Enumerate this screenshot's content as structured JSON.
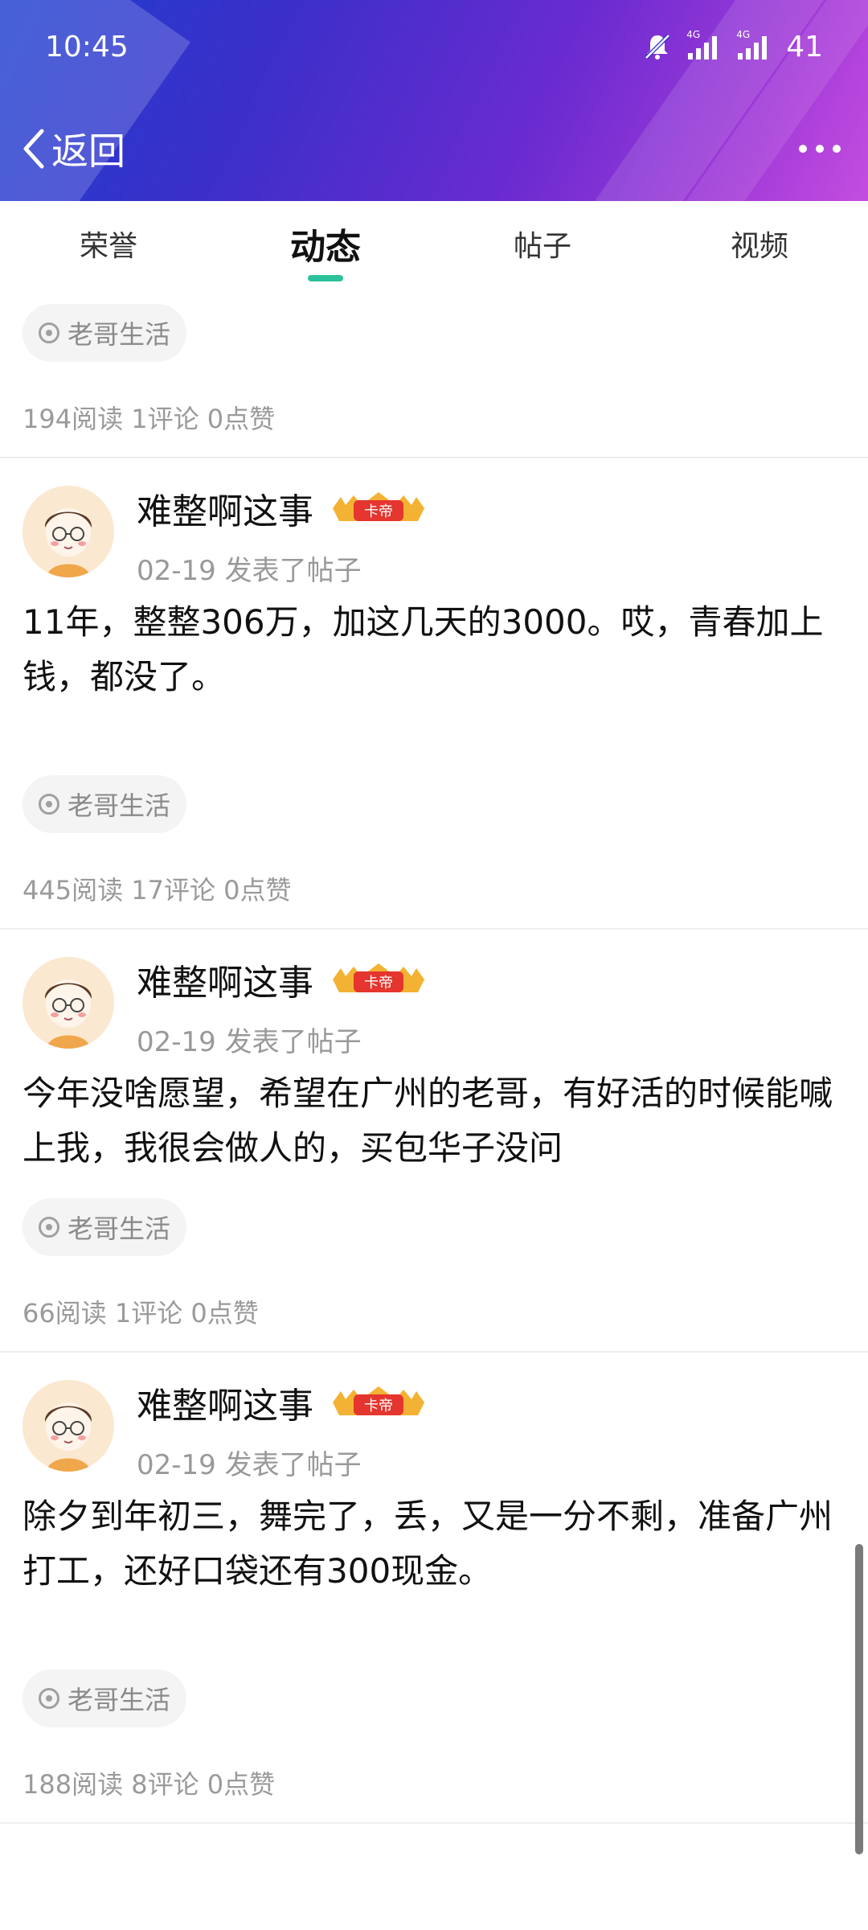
{
  "status_bar": {
    "time": "10:45",
    "battery": "41",
    "signal_label_1": "4G",
    "signal_label_2": "4G",
    "icons": [
      "mute-icon",
      "signal-icon",
      "signal-icon",
      "battery-level"
    ]
  },
  "nav": {
    "back_label": "返回",
    "more_icon": "more-dots-icon"
  },
  "tabs": [
    {
      "label": "荣誉",
      "active": false
    },
    {
      "label": "动态",
      "active": true
    },
    {
      "label": "帖子",
      "active": false
    },
    {
      "label": "视频",
      "active": false
    }
  ],
  "colors": {
    "header_gradient": [
      "#1d3fd0",
      "#6a2bd0",
      "#c44de0"
    ],
    "tab_indicator": "#2bc29b"
  },
  "feed": {
    "top_partial": {
      "topic": "老哥生活",
      "stats": "194阅读 1评论 0点赞"
    },
    "posts": [
      {
        "username": "难整啊这事",
        "badge": "卡帝",
        "meta": "02-19 发表了帖子",
        "content": "11年，整整306万，加这几天的3000。哎，青春加上钱，都没了。",
        "topic": "老哥生活",
        "stats": "445阅读 17评论 0点赞"
      },
      {
        "username": "难整啊这事",
        "badge": "卡帝",
        "meta": "02-19 发表了帖子",
        "content": "今年没啥愿望，希望在广州的老哥，有好活的时候能喊上我，我很会做人的，买包华子没问",
        "topic": "老哥生活",
        "stats": "66阅读 1评论 0点赞"
      },
      {
        "username": "难整啊这事",
        "badge": "卡帝",
        "meta": "02-19 发表了帖子",
        "content": "除夕到年初三，舞完了，丢，又是一分不剩，准备广州打工，还好口袋还有300现金。",
        "topic": "老哥生活",
        "stats": "188阅读 8评论 0点赞"
      }
    ]
  }
}
